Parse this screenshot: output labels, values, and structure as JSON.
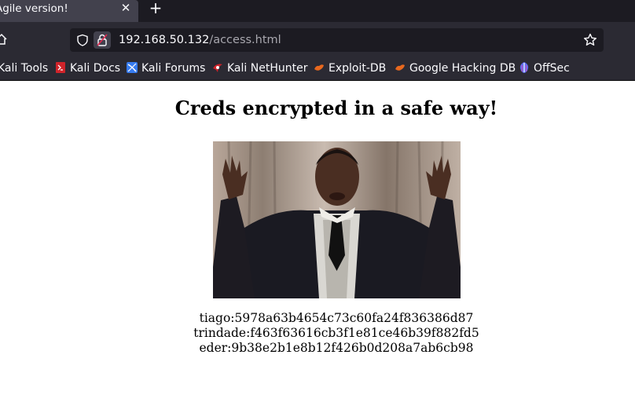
{
  "browser": {
    "tab_title": "Agile version!",
    "tab_close": "✕",
    "new_tab": "+",
    "url_host": "192.168.50.132",
    "url_path": "/access.html"
  },
  "bookmarks": [
    {
      "label": "Kali Tools",
      "icon": "none"
    },
    {
      "label": "Kali Docs",
      "icon": "kali-docs-icon",
      "color": "#d0232a"
    },
    {
      "label": "Kali Forums",
      "icon": "kali-forums-icon",
      "color": "#367bf0"
    },
    {
      "label": "Kali NetHunter",
      "icon": "kali-nethunter-icon",
      "color": "#d0232a"
    },
    {
      "label": "Exploit-DB",
      "icon": "exploit-db-icon",
      "color": "#e8681e"
    },
    {
      "label": "Google Hacking DB",
      "icon": "ghdb-icon",
      "color": "#e8681e"
    },
    {
      "label": "OffSec",
      "icon": "offsec-icon",
      "color": "#5b6cf0"
    }
  ],
  "page": {
    "heading": "Creds encrypted in a safe way!",
    "creds": [
      "tiago:5978a63b4654c73c60fa24f836386d87",
      "trindade:f463f63616cb3f1e81ce46b39f882fd5",
      "eder:9b38e2b1e8b12f426b0d208a7ab6cb98"
    ]
  }
}
